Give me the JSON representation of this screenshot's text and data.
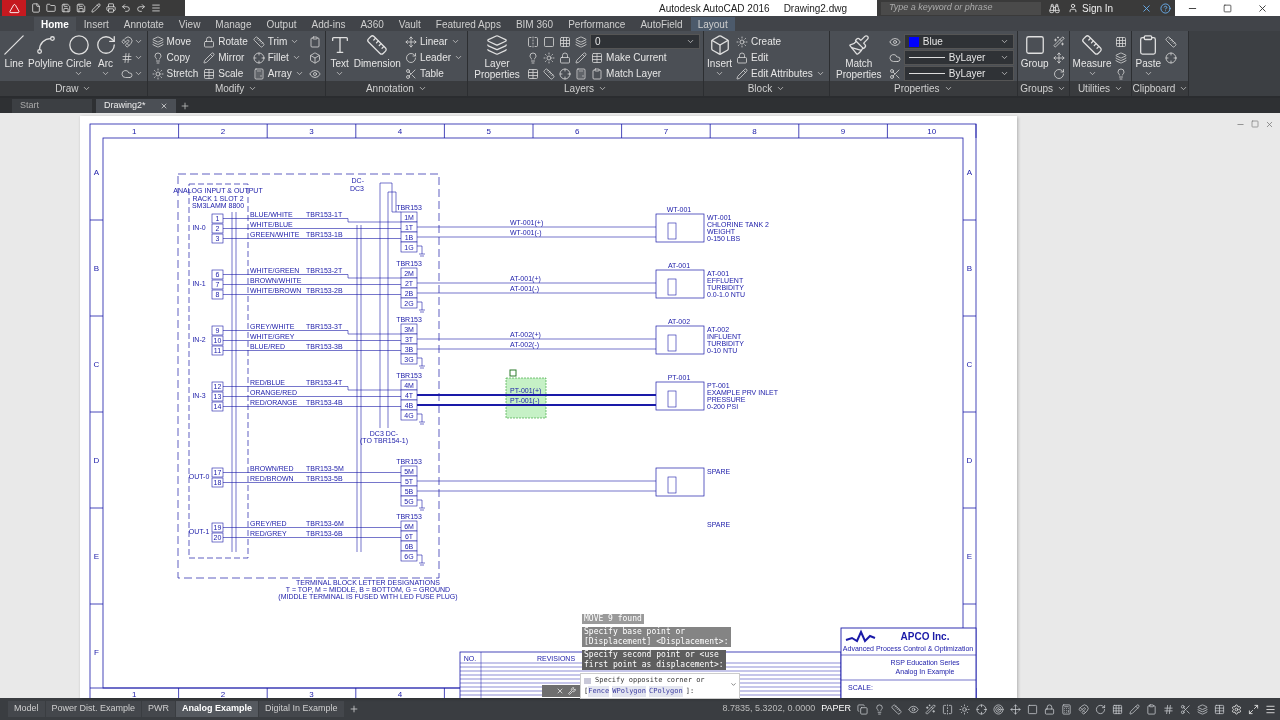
{
  "title_bar": {
    "app": "Autodesk AutoCAD 2016",
    "file": "Drawing2.dwg",
    "search": {
      "placeholder": "Type a keyword or phrase"
    },
    "sign_in": "Sign In"
  },
  "ribbon": {
    "tabs": [
      {
        "label": "Home",
        "selected": true,
        "contextual": false
      },
      {
        "label": "Insert",
        "selected": false,
        "contextual": false
      },
      {
        "label": "Annotate",
        "selected": false,
        "contextual": false
      },
      {
        "label": "View",
        "selected": false,
        "contextual": false
      },
      {
        "label": "Manage",
        "selected": false,
        "contextual": false
      },
      {
        "label": "Output",
        "selected": false,
        "contextual": false
      },
      {
        "label": "Add-ins",
        "selected": false,
        "contextual": false
      },
      {
        "label": "A360",
        "selected": false,
        "contextual": false
      },
      {
        "label": "Vault",
        "selected": false,
        "contextual": false
      },
      {
        "label": "Featured Apps",
        "selected": false,
        "contextual": false
      },
      {
        "label": "BIM 360",
        "selected": false,
        "contextual": false
      },
      {
        "label": "Performance",
        "selected": false,
        "contextual": false
      },
      {
        "label": "AutoField",
        "selected": false,
        "contextual": false
      },
      {
        "label": "Layout",
        "selected": false,
        "contextual": true
      }
    ],
    "panels": [
      {
        "title": "Draw",
        "groups": [
          {
            "kind": "large",
            "label": "Line",
            "caret": false
          },
          {
            "kind": "large",
            "label": "Polyline",
            "caret": false
          },
          {
            "kind": "large",
            "label": "Circle",
            "caret": true
          },
          {
            "kind": "large",
            "label": "Arc",
            "caret": true
          },
          {
            "kind": "columns",
            "columns": [
              [
                {
                  "kind": "icon",
                  "caret": true
                },
                {
                  "kind": "icon",
                  "caret": true
                },
                {
                  "kind": "icon",
                  "caret": true
                }
              ]
            ]
          }
        ]
      },
      {
        "title": "Modify",
        "groups": [
          {
            "kind": "columns",
            "columns": [
              [
                {
                  "kind": "tool",
                  "label": "Move",
                  "caret": false
                },
                {
                  "kind": "tool",
                  "label": "Copy",
                  "caret": false
                },
                {
                  "kind": "tool",
                  "label": "Stretch",
                  "caret": false
                }
              ],
              [
                {
                  "kind": "tool",
                  "label": "Rotate",
                  "caret": false
                },
                {
                  "kind": "tool",
                  "label": "Mirror",
                  "caret": false
                },
                {
                  "kind": "tool",
                  "label": "Scale",
                  "caret": false
                }
              ],
              [
                {
                  "kind": "tool",
                  "label": "Trim",
                  "caret": true
                },
                {
                  "kind": "tool",
                  "label": "Fillet",
                  "caret": true
                },
                {
                  "kind": "tool",
                  "label": "Array",
                  "caret": true
                }
              ],
              [
                {
                  "kind": "icon",
                  "caret": false
                },
                {
                  "kind": "icon",
                  "caret": false
                },
                {
                  "kind": "icon",
                  "caret": false
                }
              ]
            ]
          }
        ]
      },
      {
        "title": "Annotation",
        "groups": [
          {
            "kind": "large",
            "label": "Text",
            "caret": true
          },
          {
            "kind": "large",
            "label": "Dimension",
            "caret": false
          },
          {
            "kind": "columns",
            "columns": [
              [
                {
                  "kind": "tool",
                  "label": "Linear",
                  "caret": true
                },
                {
                  "kind": "tool",
                  "label": "Leader",
                  "caret": true
                },
                {
                  "kind": "tool",
                  "label": "Table",
                  "caret": false
                }
              ]
            ]
          }
        ]
      },
      {
        "title": "Layers",
        "groups": [
          {
            "kind": "large",
            "label": "Layer Properties",
            "caret": false
          },
          {
            "kind": "rows",
            "rows": [
              [
                {
                  "kind": "icon",
                  "caret": false
                },
                {
                  "kind": "icon",
                  "caret": false
                },
                {
                  "kind": "icon",
                  "caret": false
                },
                {
                  "kind": "icon",
                  "caret": false
                },
                {
                  "kind": "dropdown",
                  "value": "0"
                }
              ],
              [
                {
                  "kind": "icon",
                  "caret": false
                },
                {
                  "kind": "icon",
                  "caret": false
                },
                {
                  "kind": "icon",
                  "caret": false
                },
                {
                  "kind": "icon",
                  "caret": false
                },
                {
                  "kind": "tool",
                  "label": "Make Current",
                  "caret": false
                }
              ],
              [
                {
                  "kind": "icon",
                  "caret": false
                },
                {
                  "kind": "icon",
                  "caret": false
                },
                {
                  "kind": "icon",
                  "caret": false
                },
                {
                  "kind": "icon",
                  "caret": false
                },
                {
                  "kind": "tool",
                  "label": "Match Layer",
                  "caret": false
                }
              ]
            ]
          }
        ]
      },
      {
        "title": "Block",
        "groups": [
          {
            "kind": "large",
            "label": "Insert",
            "caret": true
          },
          {
            "kind": "columns",
            "columns": [
              [
                {
                  "kind": "tool",
                  "label": "Create",
                  "caret": false
                },
                {
                  "kind": "tool",
                  "label": "Edit",
                  "caret": false
                },
                {
                  "kind": "tool",
                  "label": "Edit Attributes",
                  "caret": true
                }
              ]
            ]
          }
        ]
      },
      {
        "title": "Properties",
        "groups": [
          {
            "kind": "large",
            "label": "Match Properties",
            "caret": false
          },
          {
            "kind": "rows",
            "rows": [
              [
                {
                  "kind": "icon",
                  "caret": false
                },
                {
                  "kind": "dropdown",
                  "value": "Blue",
                  "color": "#0000ff"
                }
              ],
              [
                {
                  "kind": "icon",
                  "caret": false
                },
                {
                  "kind": "linetype",
                  "value": "ByLayer"
                }
              ],
              [
                {
                  "kind": "icon",
                  "caret": false
                },
                {
                  "kind": "linetype",
                  "value": "ByLayer"
                }
              ]
            ]
          }
        ]
      },
      {
        "title": "Groups",
        "groups": [
          {
            "kind": "large",
            "label": "Group",
            "caret": false
          },
          {
            "kind": "columns",
            "columns": [
              [
                {
                  "kind": "icon",
                  "caret": false
                },
                {
                  "kind": "icon",
                  "caret": false
                },
                {
                  "kind": "icon",
                  "caret": false
                }
              ]
            ]
          }
        ]
      },
      {
        "title": "Utilities",
        "groups": [
          {
            "kind": "large",
            "label": "Measure",
            "caret": true
          },
          {
            "kind": "columns",
            "columns": [
              [
                {
                  "kind": "icon",
                  "caret": false
                },
                {
                  "kind": "icon",
                  "caret": false
                },
                {
                  "kind": "icon",
                  "caret": false
                }
              ]
            ]
          }
        ]
      },
      {
        "title": "Clipboard",
        "groups": [
          {
            "kind": "large",
            "label": "Paste",
            "caret": true
          },
          {
            "kind": "columns",
            "columns": [
              [
                {
                  "kind": "icon",
                  "caret": false
                },
                {
                  "kind": "icon",
                  "caret": false
                }
              ]
            ]
          }
        ]
      }
    ]
  },
  "file_tabs": [
    {
      "label": "Start",
      "selected": false,
      "closable": false
    },
    {
      "label": "Drawing2*",
      "selected": true,
      "closable": true
    }
  ],
  "drawing": {
    "frame": {
      "columns": [
        "1",
        "2",
        "3",
        "4",
        "5",
        "6",
        "7",
        "8",
        "9",
        "10"
      ],
      "bottom_columns": [
        "1",
        "2",
        "3",
        "4"
      ],
      "rows": [
        "A",
        "B",
        "C",
        "D",
        "E",
        "F"
      ],
      "right_rows": [
        "A",
        "B",
        "C",
        "D",
        "E"
      ]
    },
    "module": {
      "title": [
        "ANALOG INPUT & OUTPUT",
        "RACK 1 SLOT 2",
        "SM3LAMM 8800"
      ]
    },
    "power": {
      "top": [
        "DC-",
        "DC3"
      ],
      "bottom": [
        "DC3  DC-",
        "(TO TBR154-1)"
      ]
    },
    "channels": [
      {
        "label": "IN-0",
        "block": "TBR153",
        "cells": [
          "1M",
          "1T",
          "1B",
          "1G"
        ],
        "terminals": [
          {
            "number": "1",
            "wire": "BLUE/WHITE",
            "tag": "TBR153-1T"
          },
          {
            "number": "2",
            "wire": "WHITE/BLUE"
          },
          {
            "number": "3",
            "wire": "GREEN/WHITE",
            "tag": "TBR153-1B"
          }
        ],
        "device": {
          "tag": "WT-001",
          "plus": "WT-001(+)",
          "minus": "WT-001(-)",
          "lines": [
            "WT-001",
            "CHLORINE TANK 2",
            "WEIGHT",
            "0-150 LBS"
          ]
        }
      },
      {
        "label": "IN-1",
        "block": "TBR153",
        "cells": [
          "2M",
          "2T",
          "2B",
          "2G"
        ],
        "terminals": [
          {
            "number": "6",
            "wire": "WHITE/GREEN",
            "tag": "TBR153-2T"
          },
          {
            "number": "7",
            "wire": "BROWN/WHITE"
          },
          {
            "number": "8",
            "wire": "WHITE/BROWN",
            "tag": "TBR153-2B"
          }
        ],
        "device": {
          "tag": "AT-001",
          "plus": "AT-001(+)",
          "minus": "AT-001(-)",
          "lines": [
            "AT-001",
            "EFFLUENT",
            "TURBIDITY",
            "0.0-1.0 NTU"
          ]
        }
      },
      {
        "label": "IN-2",
        "block": "TBR153",
        "cells": [
          "3M",
          "3T",
          "3B",
          "3G"
        ],
        "terminals": [
          {
            "number": "9",
            "wire": "GREY/WHITE",
            "tag": "TBR153-3T"
          },
          {
            "number": "10",
            "wire": "WHITE/GREY"
          },
          {
            "number": "11",
            "wire": "BLUE/RED",
            "tag": "TBR153-3B"
          }
        ],
        "device": {
          "tag": "AT-002",
          "plus": "AT-002(+)",
          "minus": "AT-002(-)",
          "lines": [
            "AT-002",
            "INFLUENT",
            "TURBIDITY",
            "0-10 NTU"
          ]
        }
      },
      {
        "label": "IN-3",
        "block": "TBR153",
        "cells": [
          "4M",
          "4T",
          "4B",
          "4G"
        ],
        "terminals": [
          {
            "number": "12",
            "wire": "RED/BLUE",
            "tag": "TBR153-4T"
          },
          {
            "number": "13",
            "wire": "ORANGE/RED"
          },
          {
            "number": "14",
            "wire": "RED/ORANGE",
            "tag": "TBR153-4B"
          }
        ],
        "device": {
          "tag": "PT-001",
          "plus": "PT-001(+)",
          "minus": "PT-001(-)",
          "lines": [
            "PT-001",
            "EXAMPLE PRV INLET",
            "PRESSURE",
            "0-200 PSI"
          ]
        },
        "selected": true
      },
      {
        "label": "OUT-0",
        "block": "TBR153",
        "cells": [
          "5M",
          "5T",
          "5B",
          "5G"
        ],
        "terminals": [
          {
            "number": "17",
            "wire": "BROWN/RED",
            "tag": "TBR153-5M"
          },
          {
            "number": "18",
            "wire": "RED/BROWN",
            "tag": "TBR153-5B"
          }
        ],
        "device": {
          "lines": [
            "SPARE"
          ]
        }
      },
      {
        "label": "OUT-1",
        "block": "TBR153",
        "cells": [
          "6M",
          "6T",
          "6B",
          "6G"
        ],
        "terminals": [
          {
            "number": "19",
            "wire": "GREY/RED",
            "tag": "TBR153-6M"
          },
          {
            "number": "20",
            "wire": "RED/GREY",
            "tag": "TBR153-6B"
          }
        ],
        "spare": "SPARE"
      }
    ],
    "notes": [
      "TERMINAL BLOCK LETTER DESIGNATIONS",
      "T = TOP, M = MIDDLE, B = BOTTOM, G = GROUND",
      "(MIDDLE TERMINAL IS FUSED WITH LED FUSE PLUG)"
    ],
    "revisions": {
      "number": "NO.",
      "title": "REVISIONS"
    },
    "title_block": {
      "company": "APCO Inc.",
      "tagline": "Advanced Process Control & Optimization",
      "series": "RSP Education Series",
      "name": "Analog In Example",
      "scale": "SCALE:"
    }
  },
  "command_line": {
    "history": [
      [
        "MOVE 9 found"
      ],
      [
        "Specify base point or",
        "[Displacement] <Displacement>:"
      ],
      [
        "Specify second point or <use",
        "first point as displacement>:"
      ]
    ],
    "prompt": "Specify opposite corner or",
    "open": "[",
    "options": [
      "Fence",
      "WPolygon",
      "CPolygon"
    ],
    "close": "]:"
  },
  "layout_tabs": [
    {
      "label": "Model",
      "selected": false
    },
    {
      "label": "Power Dist. Example",
      "selected": false
    },
    {
      "label": "PWR",
      "selected": false
    },
    {
      "label": "Analog Example",
      "selected": true
    },
    {
      "label": "Digital In Example",
      "selected": false
    }
  ],
  "status_bar": {
    "coordinates": "8.7835, 5.3202, 0.0000",
    "space": "PAPER"
  }
}
